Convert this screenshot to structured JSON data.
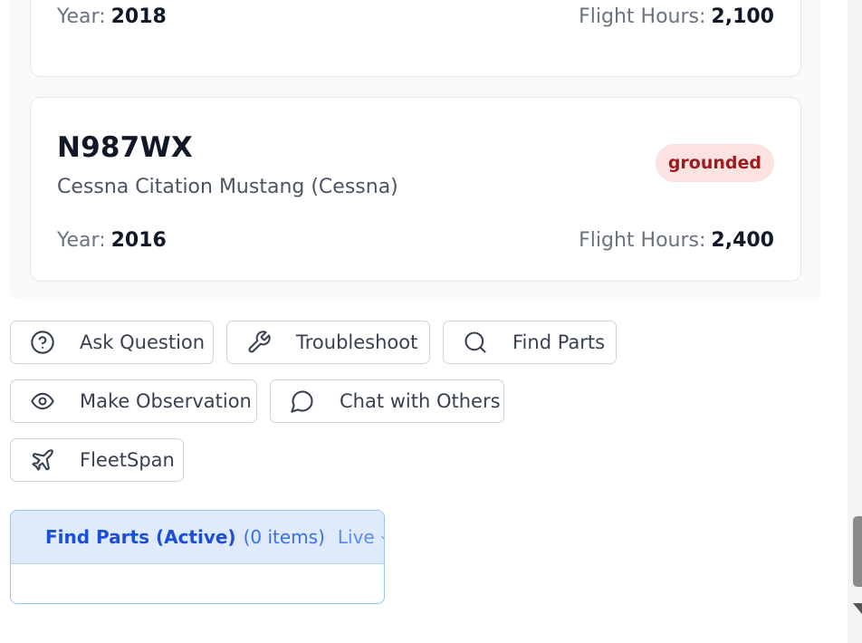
{
  "fleet": {
    "aircraft": [
      {
        "year_label": "Year:",
        "year": "2018",
        "hours_label": "Flight Hours:",
        "hours": "2,100"
      },
      {
        "tail_number": "N987WX",
        "model": "Cessna Citation Mustang (Cessna)",
        "status": "grounded",
        "year_label": "Year:",
        "year": "2016",
        "hours_label": "Flight Hours:",
        "hours": "2,400"
      }
    ]
  },
  "actions": [
    {
      "label": "Ask Question",
      "icon": "help-circle-icon"
    },
    {
      "label": "Troubleshoot",
      "icon": "wrench-icon"
    },
    {
      "label": "Find Parts",
      "icon": "search-icon"
    },
    {
      "label": "Make Observation",
      "icon": "eye-icon"
    },
    {
      "label": "Chat with Others",
      "icon": "message-circle-icon"
    },
    {
      "label": "FleetSpan",
      "icon": "plane-icon"
    }
  ],
  "active_panel": {
    "title": "Find Parts (Active)",
    "count": "(0 items)",
    "live_label": "Live"
  },
  "colors": {
    "status_grounded_bg": "#fde2e2",
    "status_grounded_text": "#9b1c1c",
    "active_accent": "#1d4ed8",
    "active_header_bg": "#dfeafc"
  }
}
